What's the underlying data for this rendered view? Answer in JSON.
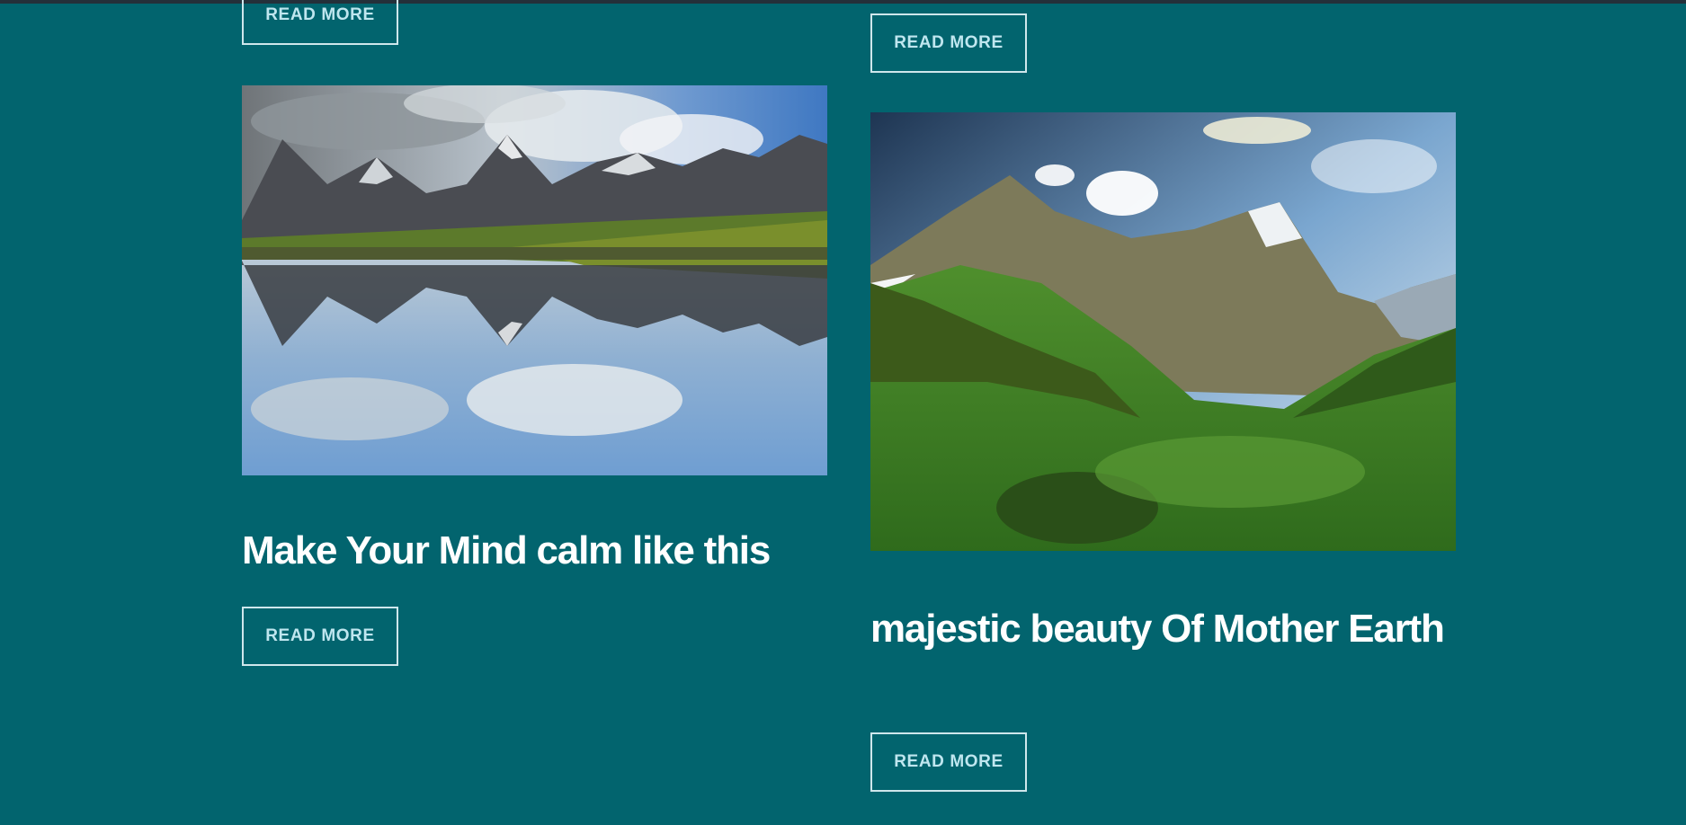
{
  "posts": [
    {
      "title": "",
      "button_label": "READ MORE"
    },
    {
      "title": "",
      "button_label": "READ MORE"
    },
    {
      "title": "Make Your Mind calm like this",
      "button_label": "READ MORE",
      "image": "mountain-lake-reflection"
    },
    {
      "title": "majestic beauty Of Mother Earth",
      "button_label": "READ MORE",
      "image": "green-mountain-valley"
    }
  ],
  "colors": {
    "page_background": "#02646e",
    "title_text": "#ffffff",
    "button_border": "#cfe7ec",
    "button_text": "#bfe6ef"
  }
}
